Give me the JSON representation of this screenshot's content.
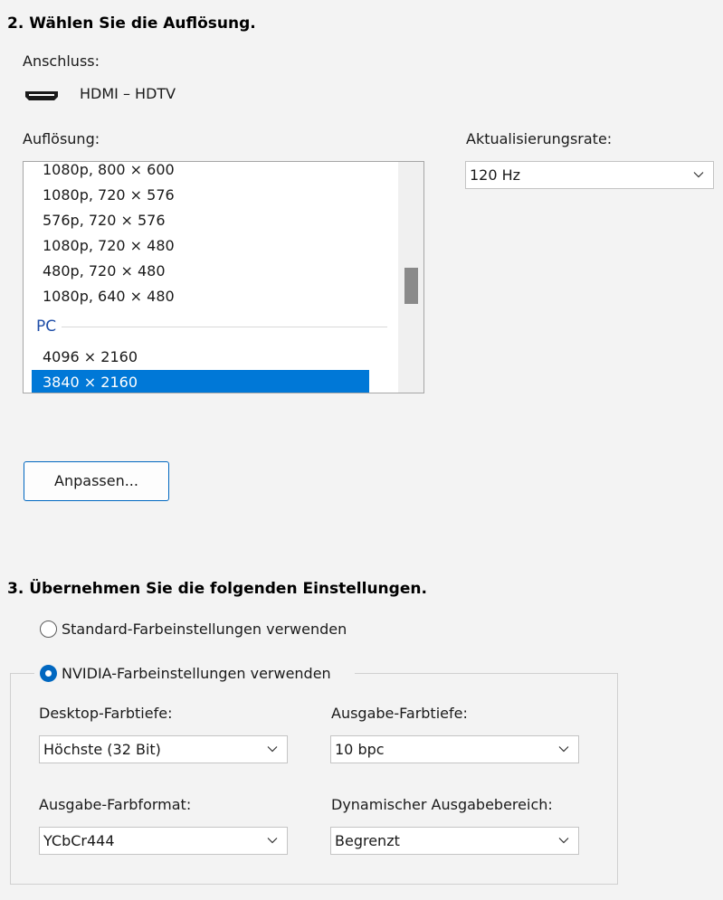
{
  "section2": {
    "title": "2. Wählen Sie die Auflösung.",
    "connector_label": "Anschluss:",
    "connector_value": "HDMI – HDTV",
    "connector_icon": "hdmi-icon",
    "resolution_label": "Auflösung:",
    "refresh_label": "Aktualisierungsrate:",
    "refresh_value": "120 Hz",
    "resolutions": [
      "1080p, 800 × 600",
      "1080p, 720 × 576",
      "576p, 720 × 576",
      "1080p, 720 × 480",
      "480p, 720 × 480",
      "1080p, 640 × 480"
    ],
    "pc_group_label": "PC",
    "pc_resolutions": [
      "4096 × 2160",
      "3840 × 2160"
    ],
    "selected_resolution": "3840 × 2160",
    "customize_button": "Anpassen..."
  },
  "section3": {
    "title": "3. Übernehmen Sie die folgenden Einstellungen.",
    "radio_default": "Standard-Farbeinstellungen verwenden",
    "radio_nvidia": "NVIDIA-Farbeinstellungen verwenden",
    "selected_radio": "nvidia",
    "desktop_depth_label": "Desktop-Farbtiefe:",
    "desktop_depth_value": "Höchste (32 Bit)",
    "output_depth_label": "Ausgabe-Farbtiefe:",
    "output_depth_value": "10 bpc",
    "output_format_label": "Ausgabe-Farbformat:",
    "output_format_value": "YCbCr444",
    "dynamic_range_label": "Dynamischer Ausgabebereich:",
    "dynamic_range_value": "Begrenzt"
  },
  "colors": {
    "accent": "#0078d7",
    "group_header": "#1f4ea8",
    "background": "#f3f3f3"
  }
}
